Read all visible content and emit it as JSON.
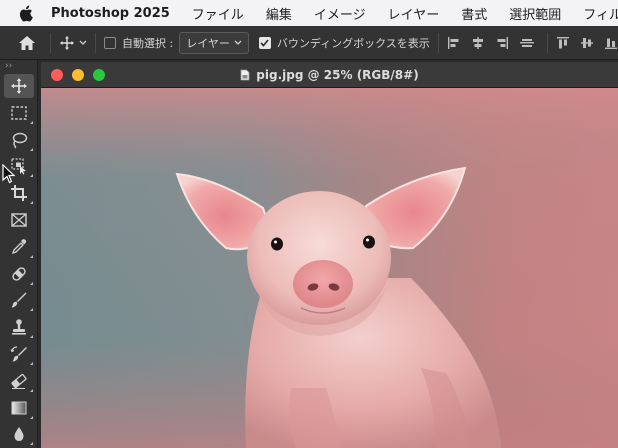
{
  "menubar": {
    "app_name": "Photoshop 2025",
    "items": [
      "ファイル",
      "編集",
      "イメージ",
      "レイヤー",
      "書式",
      "選択範囲",
      "フィルター"
    ]
  },
  "options_bar": {
    "auto_select_label": "自動選択 :",
    "auto_select_target": "レイヤー",
    "bounding_box_label": "バウンディングボックスを表示"
  },
  "document": {
    "title": "pig.jpg @ 25% (RGB/8#)"
  },
  "tools": [
    "move",
    "marquee",
    "lasso",
    "object-selection",
    "crop",
    "frame",
    "eyedropper",
    "healing-brush",
    "brush",
    "clone-stamp",
    "history-brush",
    "eraser",
    "gradient",
    "blur"
  ],
  "colors": {
    "menubar_bg": "#f3f2f5",
    "panel_bg": "#333333",
    "close": "#ff5f57",
    "minimize": "#febc2e",
    "zoom": "#28c840"
  }
}
